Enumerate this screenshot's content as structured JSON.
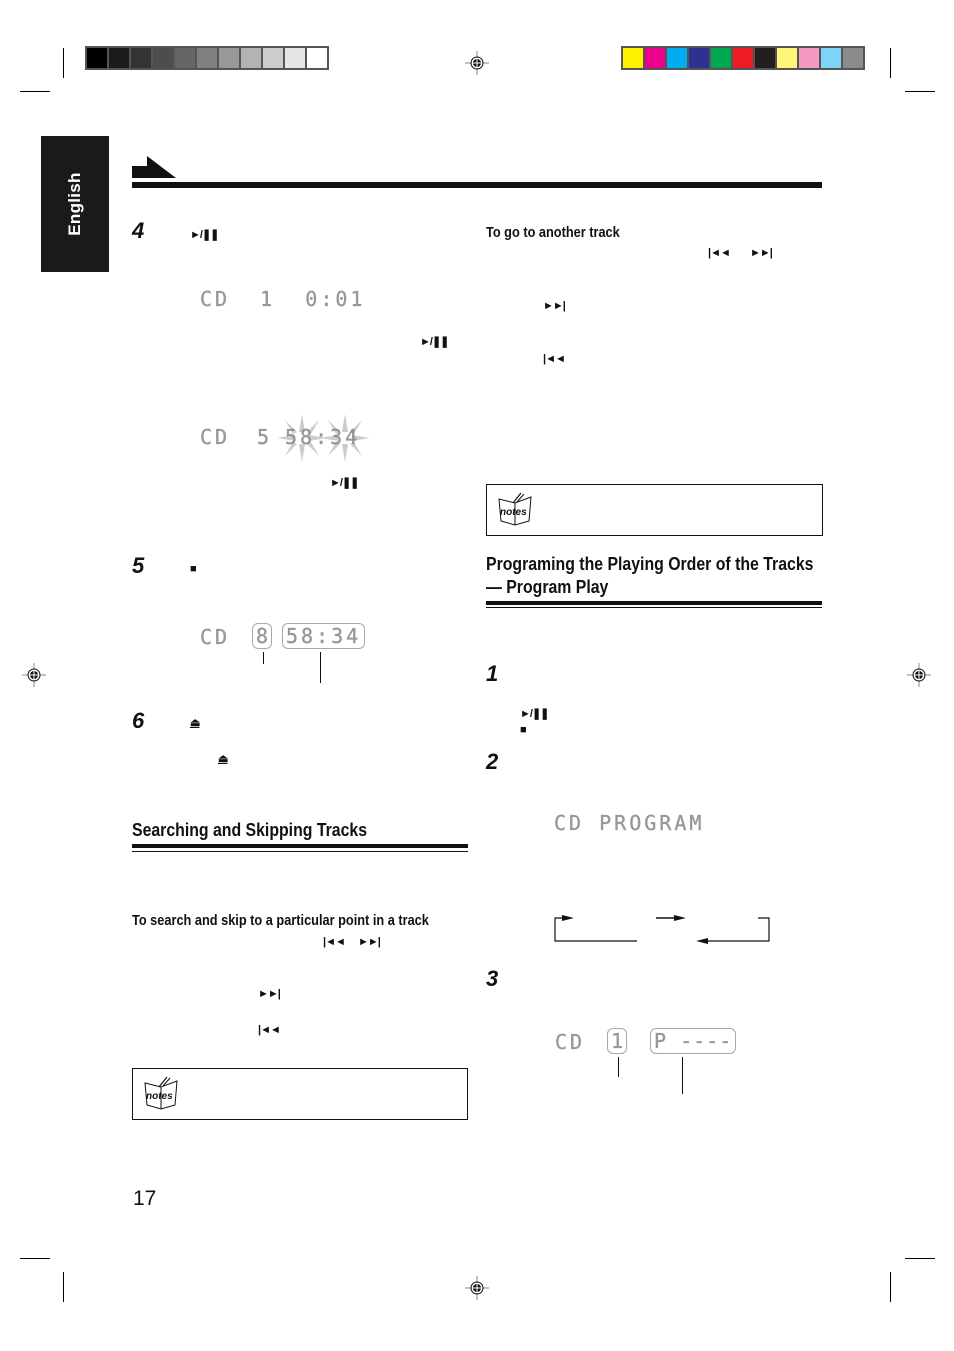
{
  "color_bars": {
    "grayscale": [
      "#000000",
      "#1a1a1a",
      "#333333",
      "#4d4d4d",
      "#666666",
      "#808080",
      "#999999",
      "#b3b3b3",
      "#cccccc",
      "#e6e6e6",
      "#ffffff"
    ],
    "process": [
      "#fff200",
      "#ec008c",
      "#00aeef",
      "#2e3192",
      "#00a651",
      "#ed1c24",
      "#231f20",
      "#fff57a",
      "#f49ac1",
      "#7fd3f7",
      "#8c8c8c"
    ]
  },
  "language_tab": "English",
  "left_column": {
    "step4": {
      "number": "4",
      "button_symbol": "►/❚❚",
      "display_play": "CD  1  0:01",
      "resume_symbol": "►/❚❚",
      "display_pause": {
        "source": "CD",
        "track": "5",
        "time": "58:34"
      },
      "pause_symbol": "►/❚❚"
    },
    "step5": {
      "number": "5",
      "button_symbol": "■",
      "display": {
        "source": "CD",
        "tracks": "8",
        "time": "58:34"
      }
    },
    "step6": {
      "number": "6",
      "button_symbol": "⏏",
      "button_symbol_2": "⏏"
    },
    "search_section": {
      "heading": "Searching and Skipping Tracks",
      "subheading": "To search and skip to a particular point in a track",
      "symbols_pair": [
        "|◄◄",
        "►►|"
      ],
      "forward_symbol": "►►|",
      "backward_symbol": "|◄◄",
      "notes_label": "notes"
    },
    "page_number": "17"
  },
  "right_column": {
    "another_track": {
      "heading": "To go to another track",
      "symbols_pair": [
        "|◄◄",
        "►►|"
      ],
      "forward_symbol": "►►|",
      "backward_symbol": "|◄◄"
    },
    "notes_label": "notes",
    "program_section": {
      "heading_line1": "Programing the Playing Order of the Tracks",
      "heading_line2": "— Program Play",
      "step1": {
        "number": "1",
        "play_symbol": "►/❚❚",
        "stop_symbol": "■"
      },
      "step2": {
        "number": "2",
        "display": "CD PROGRAM"
      },
      "step3": {
        "number": "3",
        "display": {
          "source": "CD",
          "step": "1",
          "program": "P ----"
        }
      }
    }
  }
}
